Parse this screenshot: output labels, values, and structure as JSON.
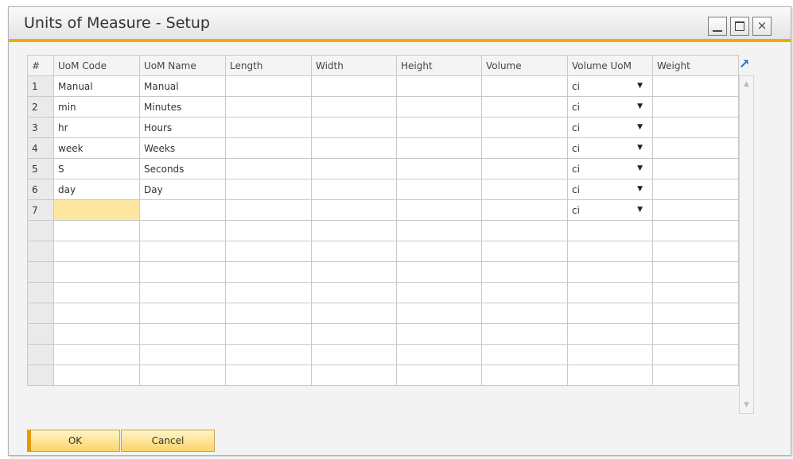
{
  "window": {
    "title": "Units of Measure - Setup",
    "accent_color": "#f0ab00"
  },
  "controls": {
    "minimize_glyph": "",
    "maximize_glyph": "",
    "close_glyph": "×"
  },
  "grid": {
    "columns": [
      "#",
      "UoM Code",
      "UoM Name",
      "Length",
      "Width",
      "Height",
      "Volume",
      "Volume UoM",
      "Weight"
    ],
    "rows": [
      {
        "num": "1",
        "code": "Manual",
        "name": "Manual",
        "vol_uom": "ci"
      },
      {
        "num": "2",
        "code": "min",
        "name": "Minutes",
        "vol_uom": "ci"
      },
      {
        "num": "3",
        "code": "hr",
        "name": "Hours",
        "vol_uom": "ci"
      },
      {
        "num": "4",
        "code": "week",
        "name": "Weeks",
        "vol_uom": "ci"
      },
      {
        "num": "5",
        "code": "S",
        "name": "Seconds",
        "vol_uom": "ci"
      },
      {
        "num": "6",
        "code": "day",
        "name": "Day",
        "vol_uom": "ci"
      },
      {
        "num": "7",
        "code": "",
        "name": "",
        "vol_uom": "ci"
      }
    ],
    "dropdown_icon": "▼",
    "expand_icon": "↗",
    "scroll_up_icon": "▲",
    "scroll_down_icon": "▼"
  },
  "buttons": {
    "ok": "OK",
    "cancel": "Cancel"
  }
}
